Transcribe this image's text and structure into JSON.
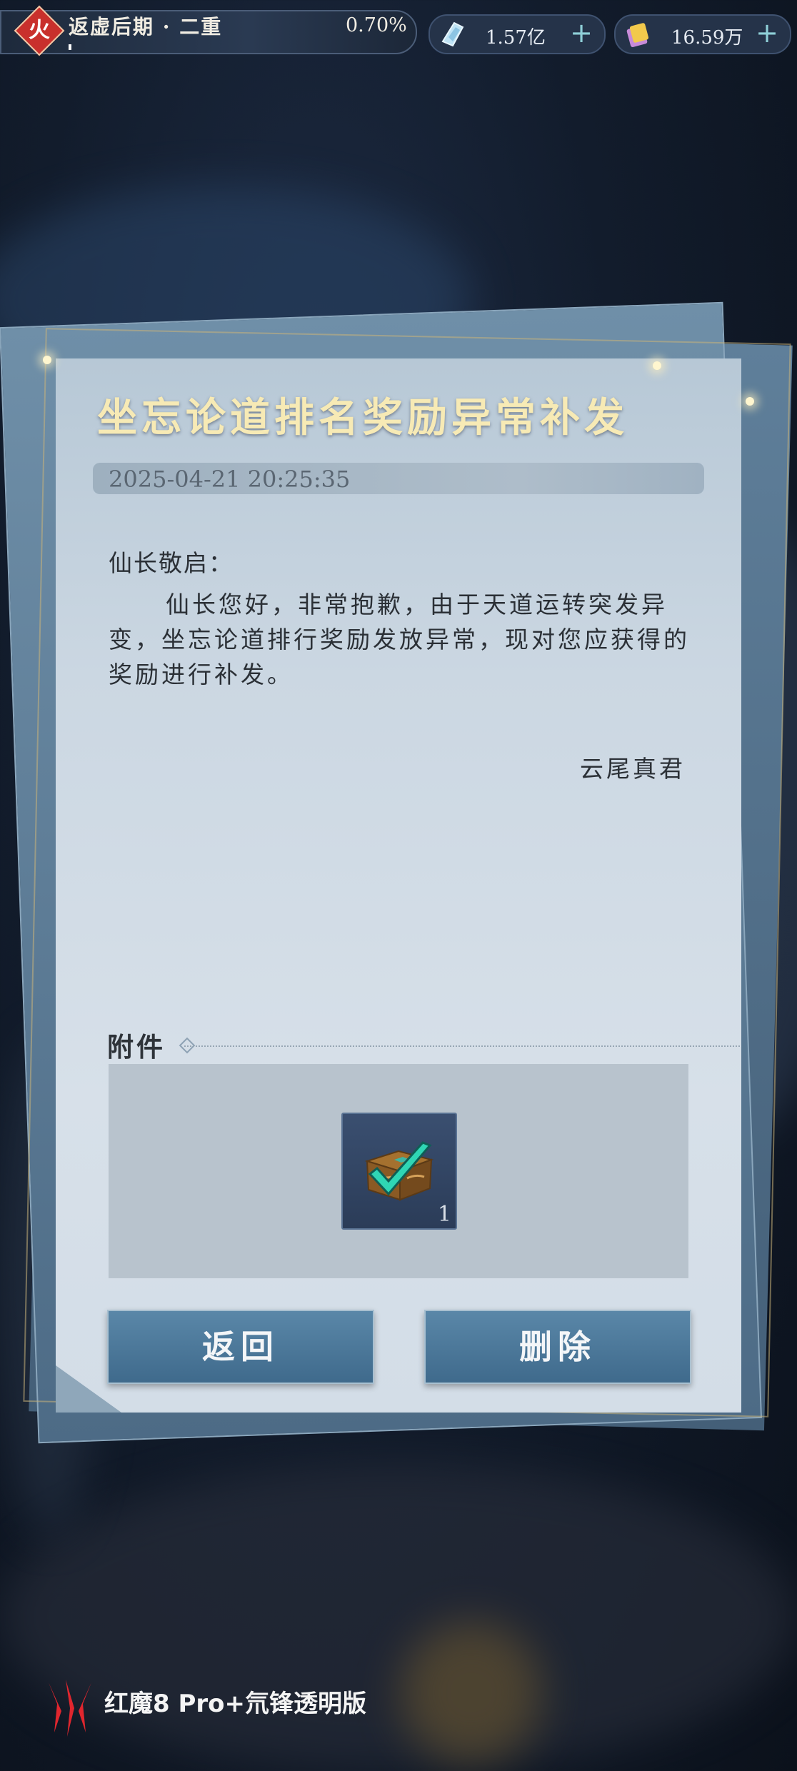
{
  "status_bar": {
    "element": "火",
    "realm": "返虚后期 · 二重",
    "realm_progress": "0.70%",
    "currency_1": {
      "icon": "spirit-stone-icon",
      "value": "1.57亿"
    },
    "currency_2": {
      "icon": "gold-ticket-icon",
      "value": "16.59万"
    },
    "plus": "+"
  },
  "mail": {
    "title": "坐忘论道排名奖励异常补发",
    "date": "2025-04-21 20:25:35",
    "greeting": "仙长敬启：",
    "body": "仙长您好，非常抱歉，由于天道运转突发异变，坐忘论道排行奖励发放异常，现对您应获得的奖励进行补发。",
    "signature": "云尾真君",
    "attachment_label": "附件",
    "attachment": {
      "icon": "treasure-chest-icon",
      "count": "1",
      "claimed": true
    }
  },
  "buttons": {
    "back": "返回",
    "delete": "删除"
  },
  "watermark": {
    "text": "红魔8 Pro+氘锋透明版"
  },
  "colors": {
    "title": "#f7eab5",
    "button": "#4a7899",
    "check": "#2fd6b4",
    "fire_badge": "#c9302c"
  }
}
